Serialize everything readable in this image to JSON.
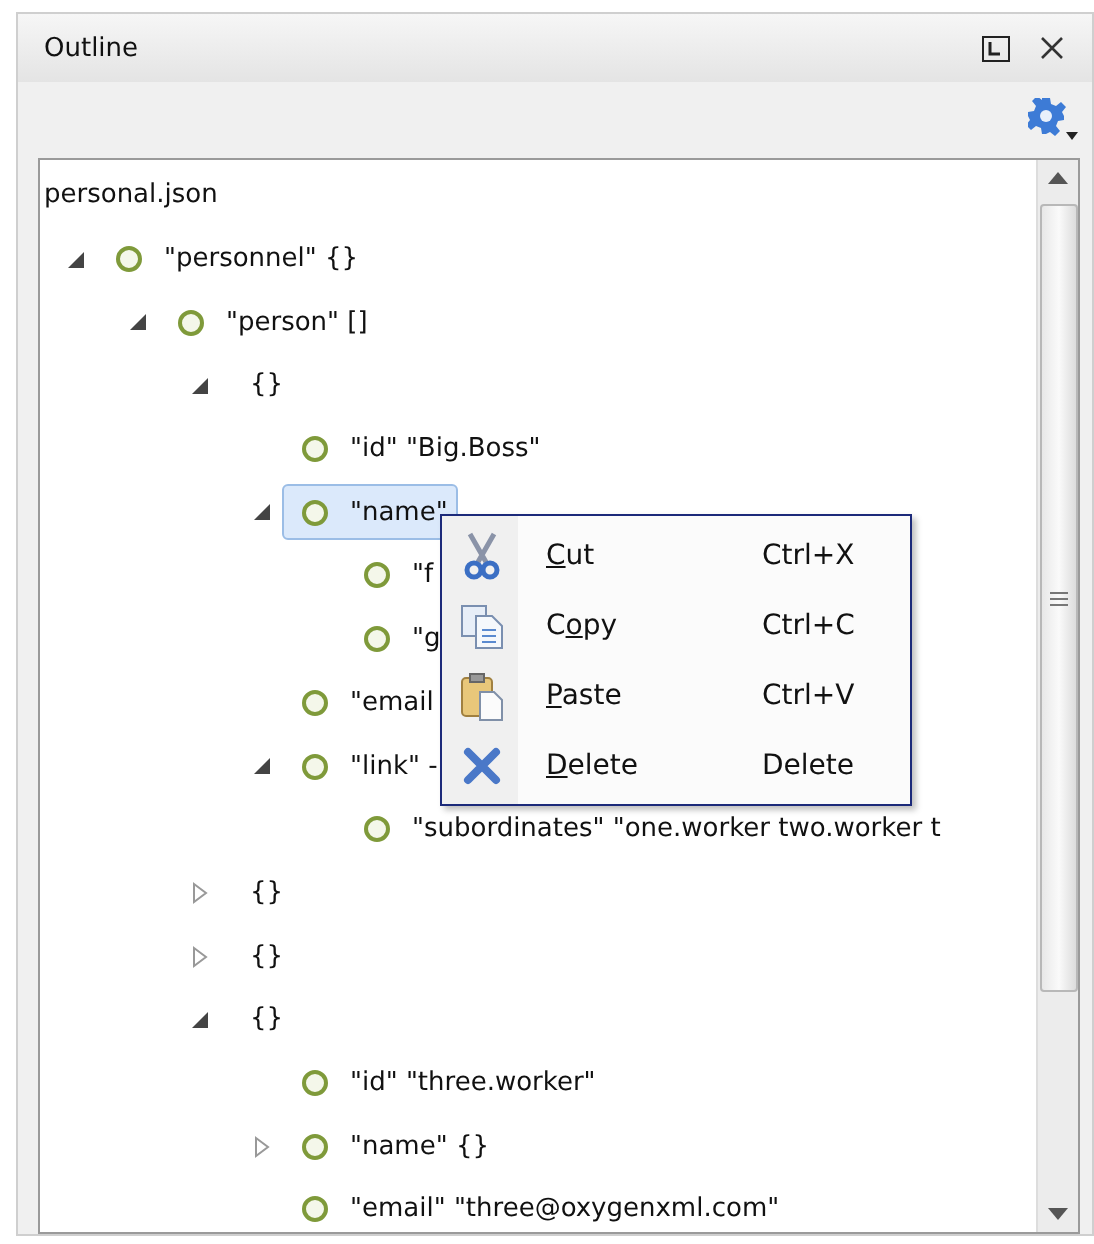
{
  "panel": {
    "title": "Outline"
  },
  "tree": {
    "root": "personal.json",
    "nodes": [
      {
        "text": "\"personnel\" {}",
        "kind": "member",
        "expanded": true,
        "selected": false,
        "children": [
          {
            "text": "\"person\" []",
            "kind": "member",
            "expanded": true,
            "selected": false,
            "children": [
              {
                "text": "{}",
                "kind": "object",
                "expanded": true,
                "selected": false,
                "children": [
                  {
                    "text": "\"id\" \"Big.Boss\"",
                    "kind": "member",
                    "selected": false
                  },
                  {
                    "text": "\"name\"",
                    "kind": "member",
                    "expanded": true,
                    "selected": true,
                    "children": [
                      {
                        "text": "\"f",
                        "kind": "member",
                        "selected": false
                      },
                      {
                        "text": "\"g",
                        "kind": "member",
                        "selected": false
                      }
                    ]
                  },
                  {
                    "text": "\"email",
                    "kind": "member",
                    "selected": false
                  },
                  {
                    "text": "\"link\" -",
                    "kind": "member",
                    "expanded": true,
                    "selected": false,
                    "children": [
                      {
                        "text": "\"subordinates\" \"one.worker two.worker t",
                        "kind": "member",
                        "selected": false
                      }
                    ]
                  }
                ]
              },
              {
                "text": "{}",
                "kind": "object",
                "expanded": false,
                "selected": false
              },
              {
                "text": "{}",
                "kind": "object",
                "expanded": false,
                "selected": false
              },
              {
                "text": "{}",
                "kind": "object",
                "expanded": true,
                "selected": false,
                "children": [
                  {
                    "text": "\"id\" \"three.worker\"",
                    "kind": "member",
                    "selected": false
                  },
                  {
                    "text": "\"name\" {}",
                    "kind": "member",
                    "expanded": false,
                    "selected": false
                  },
                  {
                    "text": "\"email\" \"three@oxygenxml.com\"",
                    "kind": "member",
                    "selected": false
                  }
                ]
              }
            ]
          }
        ]
      }
    ]
  },
  "context_menu": [
    {
      "kind": "cut",
      "mnemonic": "C",
      "label_after": "ut",
      "shortcut": "Ctrl+X"
    },
    {
      "kind": "copy",
      "label_before": "C",
      "mnemonic": "o",
      "label_after": "py",
      "shortcut": "Ctrl+C"
    },
    {
      "kind": "paste",
      "mnemonic": "P",
      "label_after": "aste",
      "shortcut": "Ctrl+V"
    },
    {
      "kind": "delete",
      "mnemonic": "D",
      "label_after": "elete",
      "shortcut": "Delete"
    }
  ]
}
